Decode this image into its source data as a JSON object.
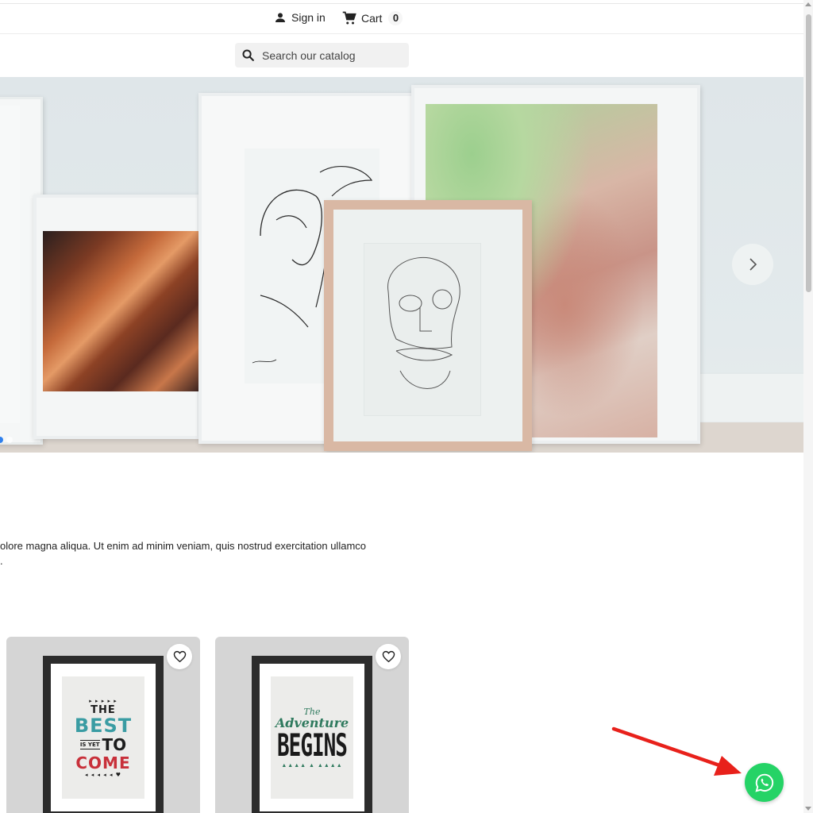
{
  "header": {
    "sign_in_label": "Sign in",
    "cart_label": "Cart",
    "cart_count": "0",
    "search_placeholder": "Search our catalog"
  },
  "hero": {
    "slides_count": 2,
    "active_slide": 1,
    "next_icon": "chevron-right-icon"
  },
  "intro": {
    "line1": "olore magna aliqua. Ut enim ad minim veniam, quis nostrud exercitation ullamco",
    "line2": "."
  },
  "products": [
    {
      "wishlist_icon": "heart-outline-icon",
      "poster": {
        "arrows_top": "▸ ▸ ▸ ▸ ▸",
        "the": "THE",
        "best": "BEST",
        "is_yet": "IS YET",
        "to": "TO",
        "come": "COME",
        "arrows_bottom": "◂ ◂ ◂ ◂ ◂ ♥"
      }
    },
    {
      "wishlist_icon": "heart-outline-icon",
      "poster": {
        "the": "The",
        "adventure": "Adventure",
        "begins": "BEGINS",
        "deco": "▲▲▲▲ ▲ ▲▲▲▲"
      }
    }
  ],
  "floating": {
    "whatsapp_icon": "whatsapp-icon"
  },
  "annotation": {
    "arrow_color": "#e8211b"
  },
  "colors": {
    "accent": "#25d366",
    "slider_dot_active": "#2f80ed",
    "card_bg": "#d5d5d5"
  }
}
